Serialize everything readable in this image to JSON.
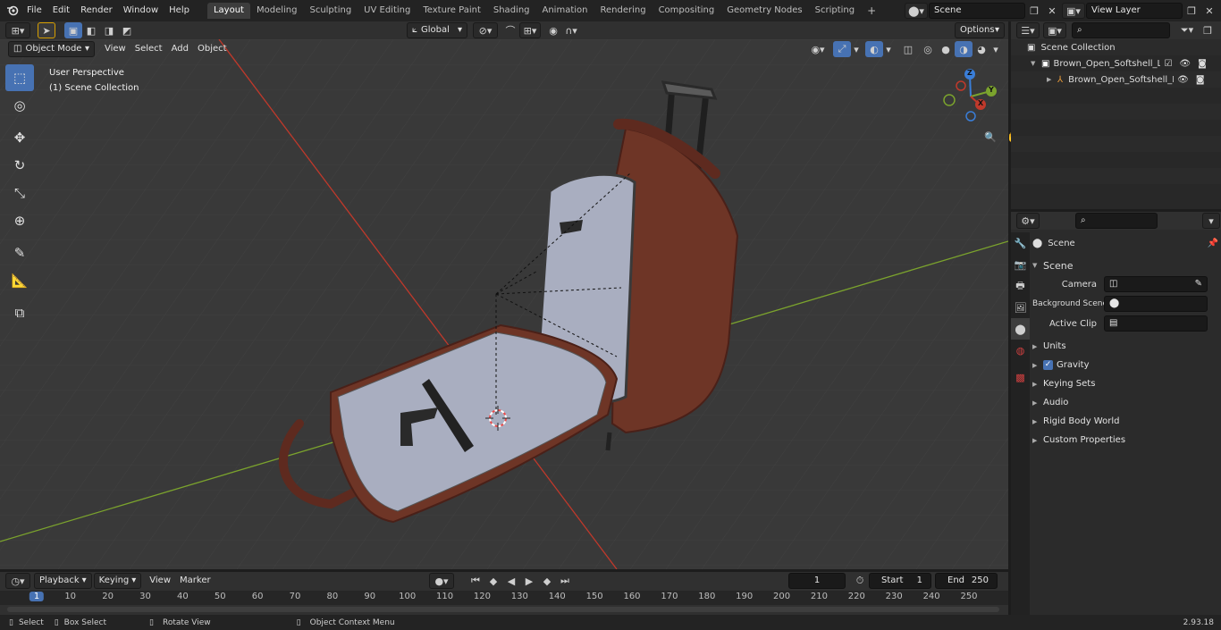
{
  "topbar": {
    "menus": [
      "File",
      "Edit",
      "Render",
      "Window",
      "Help"
    ],
    "workspaces": [
      "Layout",
      "Modeling",
      "Sculpting",
      "UV Editing",
      "Texture Paint",
      "Shading",
      "Animation",
      "Rendering",
      "Compositing",
      "Geometry Nodes",
      "Scripting"
    ],
    "active_workspace": "Layout",
    "add_tab": "+",
    "scene_name": "Scene",
    "view_layer": "View Layer"
  },
  "tool_header": {
    "orientation": "Global",
    "options": "Options"
  },
  "viewport_header": {
    "mode": "Object Mode",
    "menus": [
      "View",
      "Select",
      "Add",
      "Object"
    ]
  },
  "viewport": {
    "perspective": "User Perspective",
    "collection": "(1) Scene Collection",
    "gizmo_axes": {
      "z": "Z",
      "y": "Y",
      "x": "X"
    }
  },
  "outliner": {
    "root": "Scene Collection",
    "items": [
      {
        "label": "Brown_Open_Softshell_Lugga"
      },
      {
        "label": "Brown_Open_Softshell_L"
      }
    ]
  },
  "properties": {
    "context": "Scene",
    "panel_title": "Scene",
    "fields": [
      {
        "label": "Camera",
        "value": ""
      },
      {
        "label": "Background Scene",
        "value": ""
      },
      {
        "label": "Active Clip",
        "value": ""
      }
    ],
    "subpanels": [
      "Units",
      "Gravity",
      "Keying Sets",
      "Audio",
      "Rigid Body World",
      "Custom Properties"
    ]
  },
  "timeline": {
    "menus": [
      "Playback",
      "Keying",
      "View",
      "Marker"
    ],
    "current_frame": "1",
    "start_label": "Start",
    "start": "1",
    "end_label": "End",
    "end": "250",
    "ticks": [
      "1",
      "10",
      "20",
      "30",
      "40",
      "50",
      "60",
      "70",
      "80",
      "90",
      "100",
      "110",
      "120",
      "130",
      "140",
      "150",
      "160",
      "170",
      "180",
      "190",
      "200",
      "210",
      "220",
      "230",
      "240",
      "250"
    ]
  },
  "statusbar": {
    "select": "Select",
    "box_select": "Box Select",
    "rotate_view": "Rotate View",
    "context_menu": "Object Context Menu",
    "version": "2.93.18"
  },
  "colors": {
    "accent": "#4772b3",
    "x_axis": "#c0392b",
    "y_axis": "#7ba32d",
    "z_axis": "#3a7ed8",
    "luggage_shell": "#6e3526",
    "lining": "#a9aec0"
  }
}
